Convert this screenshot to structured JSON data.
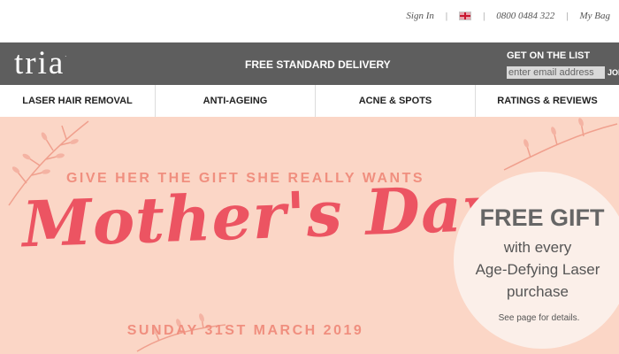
{
  "top_links": {
    "sign_in": "Sign In",
    "phone": "0800 0484 322",
    "bag": "My Bag",
    "flag_icon": "uk-flag-icon"
  },
  "header": {
    "logo": "tria",
    "logo_mark": ".",
    "delivery": "FREE STANDARD DELIVERY",
    "newsletter_title": "GET ON THE LIST",
    "email_placeholder": "enter email address",
    "join_label": "JOIN"
  },
  "nav": {
    "items": [
      {
        "label": "LASER HAIR REMOVAL"
      },
      {
        "label": "ANTI-AGEING"
      },
      {
        "label": "ACNE & SPOTS"
      },
      {
        "label": "RATINGS & REVIEWS"
      }
    ]
  },
  "banner": {
    "subhead": "GIVE HER THE GIFT SHE REALLY WANTS",
    "headline": "Mother's Day",
    "date": "SUNDAY 31ST MARCH 2019",
    "offer": {
      "title": "FREE GIFT",
      "line1": "with every",
      "line2": "Age-Defying Laser",
      "line3": "purchase",
      "note": "See page for details."
    },
    "colors": {
      "background": "#fbd6c6",
      "accent": "#ec5462",
      "text_light": "#f08f7f"
    }
  }
}
